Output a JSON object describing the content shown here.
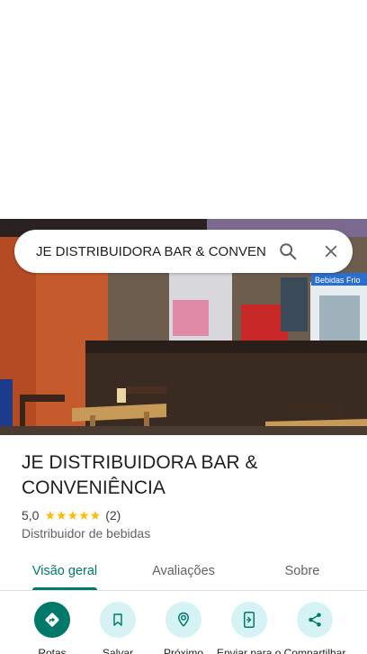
{
  "search": {
    "query": "JE DISTRIBUIDORA BAR & CONVENI",
    "search_icon": "search-icon",
    "close_icon": "close-icon"
  },
  "hero": {
    "sign_text": "Bebidas Frio"
  },
  "place": {
    "name": "JE DISTRIBUIDORA BAR & CONVENIÊNCIA",
    "rating": "5,0",
    "stars": "★★★★★",
    "review_count": "(2)",
    "category": "Distribuidor de bebidas"
  },
  "tabs": [
    {
      "label": "Visão geral",
      "active": true
    },
    {
      "label": "Avaliações",
      "active": false
    },
    {
      "label": "Sobre",
      "active": false
    }
  ],
  "actions": [
    {
      "label": "Rotas",
      "icon": "directions-icon"
    },
    {
      "label": "Salvar",
      "icon": "bookmark-icon"
    },
    {
      "label": "Próximo",
      "icon": "nearby-icon"
    },
    {
      "label": "Enviar para o telefone",
      "icon": "send-to-phone-icon"
    },
    {
      "label": "Compartilhar",
      "icon": "share-icon"
    }
  ],
  "colors": {
    "accent": "#00796b",
    "action_bg": "#d5f3f5",
    "star": "#fbbc04"
  }
}
